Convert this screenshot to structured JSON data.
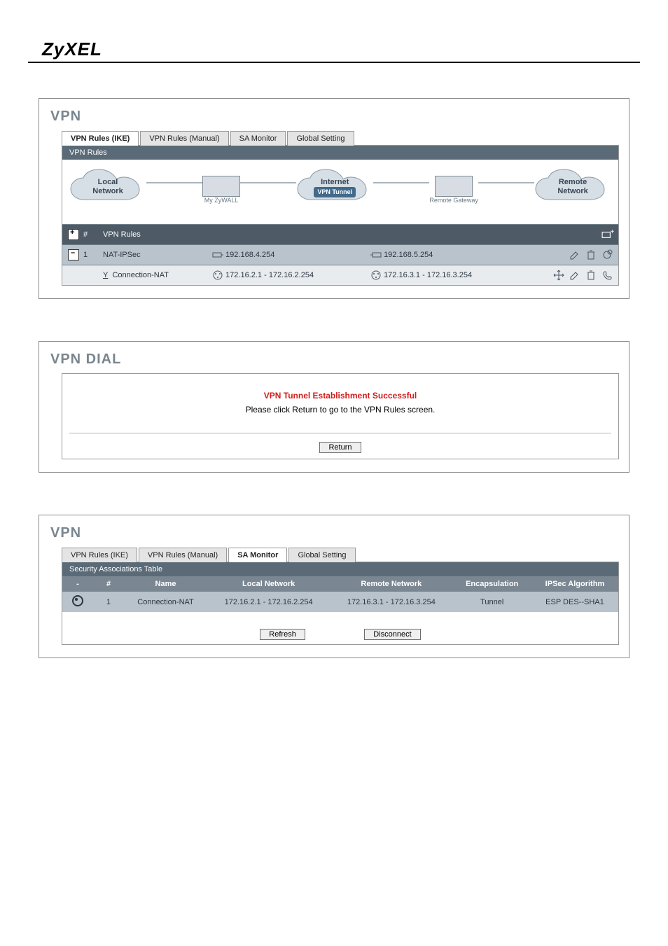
{
  "brand": "ZyXEL",
  "panel1": {
    "title": "VPN",
    "tabs": [
      "VPN Rules (IKE)",
      "VPN Rules (Manual)",
      "SA Monitor",
      "Global Setting"
    ],
    "active_tab": 0,
    "section_bar": "VPN Rules",
    "clouds": {
      "local": "Local\nNetwork",
      "my_zywall": "My ZyWALL",
      "internet": "Internet",
      "vpn_tunnel_badge": "VPN Tunnel",
      "remote_gateway": "Remote Gateway",
      "remote": "Remote\nNetwork"
    },
    "header_row": {
      "num_label": "#",
      "name": "VPN Rules"
    },
    "gateway_row": {
      "index": "1",
      "name": "NAT-IPSec",
      "local_gw": "192.168.4.254",
      "remote_gw": "192.168.5.254"
    },
    "policy_row": {
      "active_marker": "Y",
      "name": "Connection-NAT",
      "local_net": "172.16.2.1 - 172.16.2.254",
      "remote_net": "172.16.3.1 - 172.16.3.254"
    }
  },
  "panel2": {
    "title": "VPN DIAL",
    "success": "VPN Tunnel Establishment Successful",
    "hint": "Please click Return to go to the VPN Rules screen.",
    "return_btn": "Return"
  },
  "panel3": {
    "title": "VPN",
    "tabs": [
      "VPN Rules (IKE)",
      "VPN Rules (Manual)",
      "SA Monitor",
      "Global Setting"
    ],
    "active_tab": 2,
    "section_bar": "Security Associations Table",
    "columns": [
      "-",
      "#",
      "Name",
      "Local Network",
      "Remote Network",
      "Encapsulation",
      "IPSec Algorithm"
    ],
    "row": {
      "num": "1",
      "name": "Connection-NAT",
      "local": "172.16.2.1 - 172.16.2.254",
      "remote": "172.16.3.1 - 172.16.3.254",
      "encap": "Tunnel",
      "alg": "ESP DES--SHA1"
    },
    "refresh_btn": "Refresh",
    "disconnect_btn": "Disconnect"
  }
}
